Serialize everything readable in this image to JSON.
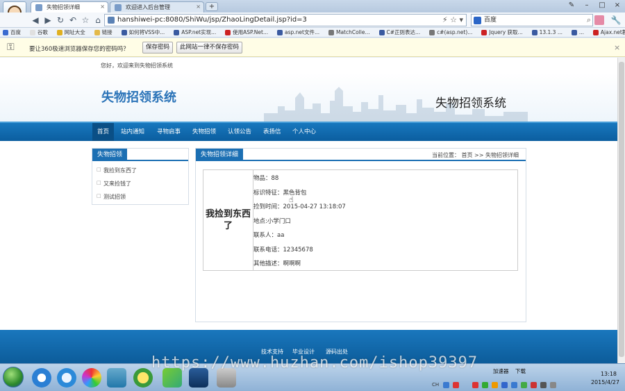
{
  "browser": {
    "tabs": [
      {
        "label": "失物招领详细"
      },
      {
        "label": "欢迎进入后台管理"
      }
    ],
    "new_tab_label": "+",
    "url": "hanshiwei-pc:8080/ShiWu/jsp/ZhaoLingDetail.jsp?id=3",
    "search_engine": "百度",
    "bookmarks": [
      "百度",
      "谷歌",
      "网址大全",
      "链接",
      "如何将VSS中...",
      "ASP.net实现...",
      "使用ASP.Net...",
      "asp.net文件...",
      "MatchColle...",
      "C#正则表达...",
      "c#(asp.net)...",
      "Jquery 获取...",
      "13.1.3 ...",
      "...",
      "Ajax.net教程..."
    ],
    "infobar": {
      "message": "要让360极速浏览器保存您的密码吗？",
      "save_label": "保存密码",
      "never_label": "此网站一律不保存密码",
      "close": "×"
    }
  },
  "site": {
    "welcome": "您好，欢迎来到失物招领系统",
    "logo_text": "失物招领系统",
    "title_right": "失物招领系统",
    "nav": [
      "首页",
      "站内通知",
      "寻物启事",
      "失物招领",
      "认领公告",
      "表扬信",
      "个人中心"
    ],
    "sidebar": {
      "title": "失物招领",
      "items": [
        "我捡到东西了",
        "又来捡钱了",
        "测试招领"
      ]
    },
    "main": {
      "title": "失物招领详细",
      "breadcrumb": "当前位置： 首页 >>  失物招领详细",
      "item_name": "我捡到东西了",
      "fields": [
        "物品：88",
        "标识特征：黑色背包",
        "捡到时间：2015-04-27 13:18:07",
        "地点:小学门口",
        "联系人：aa",
        "联系电话：12345678",
        "其他描述：啊啊啊"
      ]
    },
    "footer": [
      "技术支持",
      "毕业设计",
      "源码出处"
    ]
  },
  "taskbar": {
    "watermark": "https://www.huzhan.com/ishop39397",
    "tray_labels": [
      "加速器",
      "下载"
    ],
    "time": "13:18",
    "date": "2015/4/27",
    "ime": "CH"
  },
  "colors": {
    "brand_blue": "#1b6fb3",
    "nav_blue": "#0b5e9f"
  }
}
